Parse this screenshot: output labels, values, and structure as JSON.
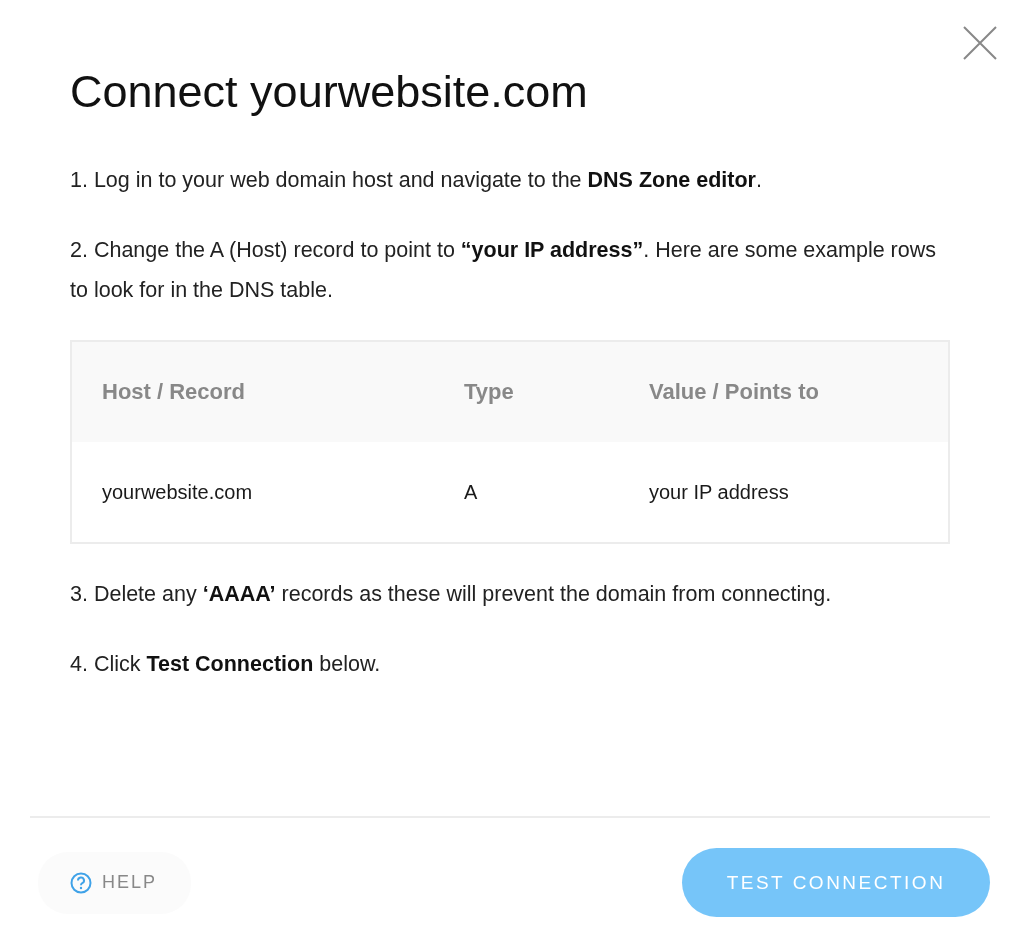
{
  "dialog": {
    "title": "Connect yourwebsite.com",
    "content": [
      {
        "kind": "step",
        "text": "1. Log in to your web domain host and navigate to the **DNS Zone editor**."
      },
      {
        "kind": "step",
        "text": "2. Change the A (Host) record to point to **“your IP address”**. Here are some example rows to look for in the DNS table."
      },
      {
        "kind": "table",
        "columns": [
          "Host / Record",
          "Type",
          "Value / Points to"
        ],
        "rows": [
          [
            "yourwebsite.com",
            "A",
            "your IP address"
          ]
        ]
      },
      {
        "kind": "step",
        "text": "3. Delete any **‘AAAA’** records as these will prevent the domain from connecting."
      },
      {
        "kind": "step",
        "text": "4. Click **Test Connection** below."
      }
    ],
    "footer": {
      "help_button": "HELP",
      "primary_button": "TEST CONNECTION"
    }
  }
}
